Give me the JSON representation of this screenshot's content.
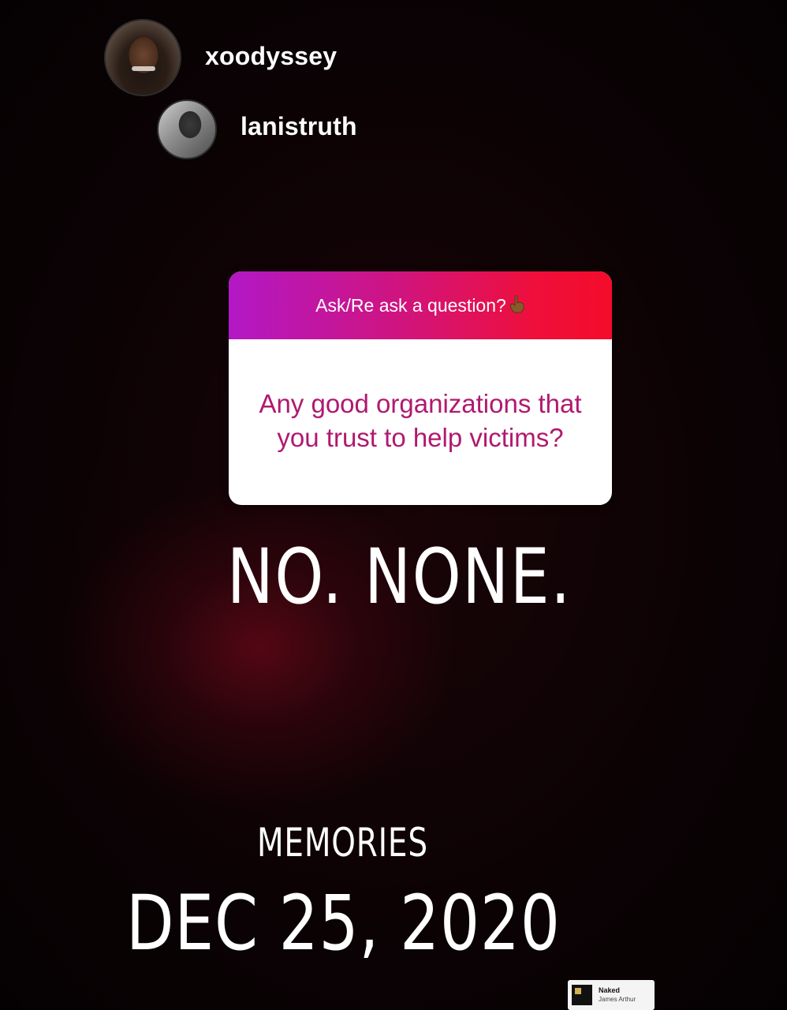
{
  "users": [
    {
      "username": "xoodyssey"
    },
    {
      "username": "lanistruth"
    }
  ],
  "question_card": {
    "header": "Ask/Re ask a question?",
    "header_icon": "pointing-hand-emoji-icon",
    "question": "Any good organizations that you trust to help victims?",
    "colors": {
      "gradient_start": "#b218c6",
      "gradient_end": "#f40c2a",
      "question_text": "#b0196f"
    }
  },
  "answer": "NO. NONE.",
  "memories_label": "MEMORIES",
  "date": "DEC 25, 2020",
  "music": {
    "title": "Naked",
    "artist": "James Arthur"
  }
}
